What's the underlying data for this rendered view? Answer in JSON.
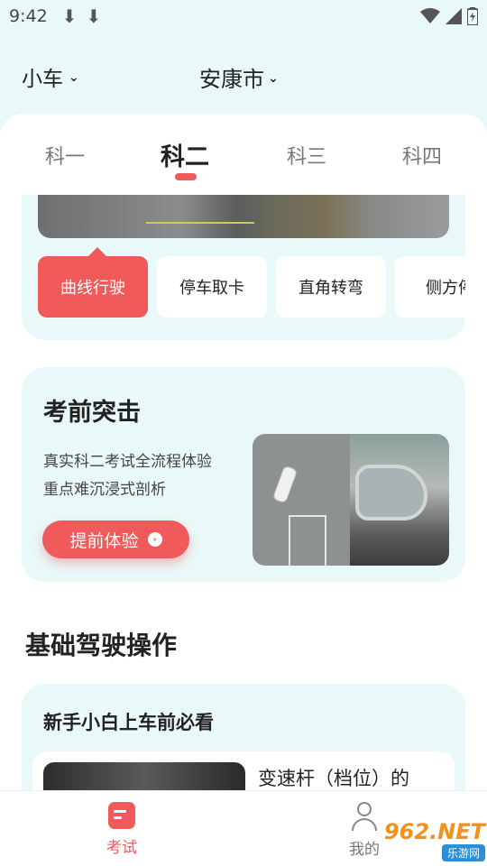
{
  "status_bar": {
    "time": "9:42",
    "download_icons": [
      "⬇",
      "⬇"
    ],
    "wifi_icon": "wifi-icon",
    "signal_icon": "signal-icon",
    "battery_icon": "battery-icon"
  },
  "header": {
    "vehicle_type": "小车",
    "city": "安康市"
  },
  "tabs": [
    {
      "label": "科一",
      "active": false
    },
    {
      "label": "科二",
      "active": true
    },
    {
      "label": "科三",
      "active": false
    },
    {
      "label": "科四",
      "active": false
    }
  ],
  "topics": [
    {
      "label": "曲线行驶",
      "active": true
    },
    {
      "label": "停车取卡",
      "active": false
    },
    {
      "label": "直角转弯",
      "active": false
    },
    {
      "label": "侧方停",
      "active": false
    }
  ],
  "promo": {
    "title": "考前突击",
    "line1": "真实科二考试全流程体验",
    "line2": "重点难沉浸式剖析",
    "cta_label": "提前体验"
  },
  "basics": {
    "section_title": "基础驾驶操作",
    "card_title": "新手小白上车前必看",
    "item_title": "变速杆（档位）的"
  },
  "bottom_nav": {
    "exam_label": "考试",
    "mine_label": "我的"
  },
  "watermark": {
    "big": "962.NET",
    "small": "乐游网"
  },
  "colors": {
    "accent": "#f05a5a",
    "card_bg": "#e9f8f8"
  }
}
